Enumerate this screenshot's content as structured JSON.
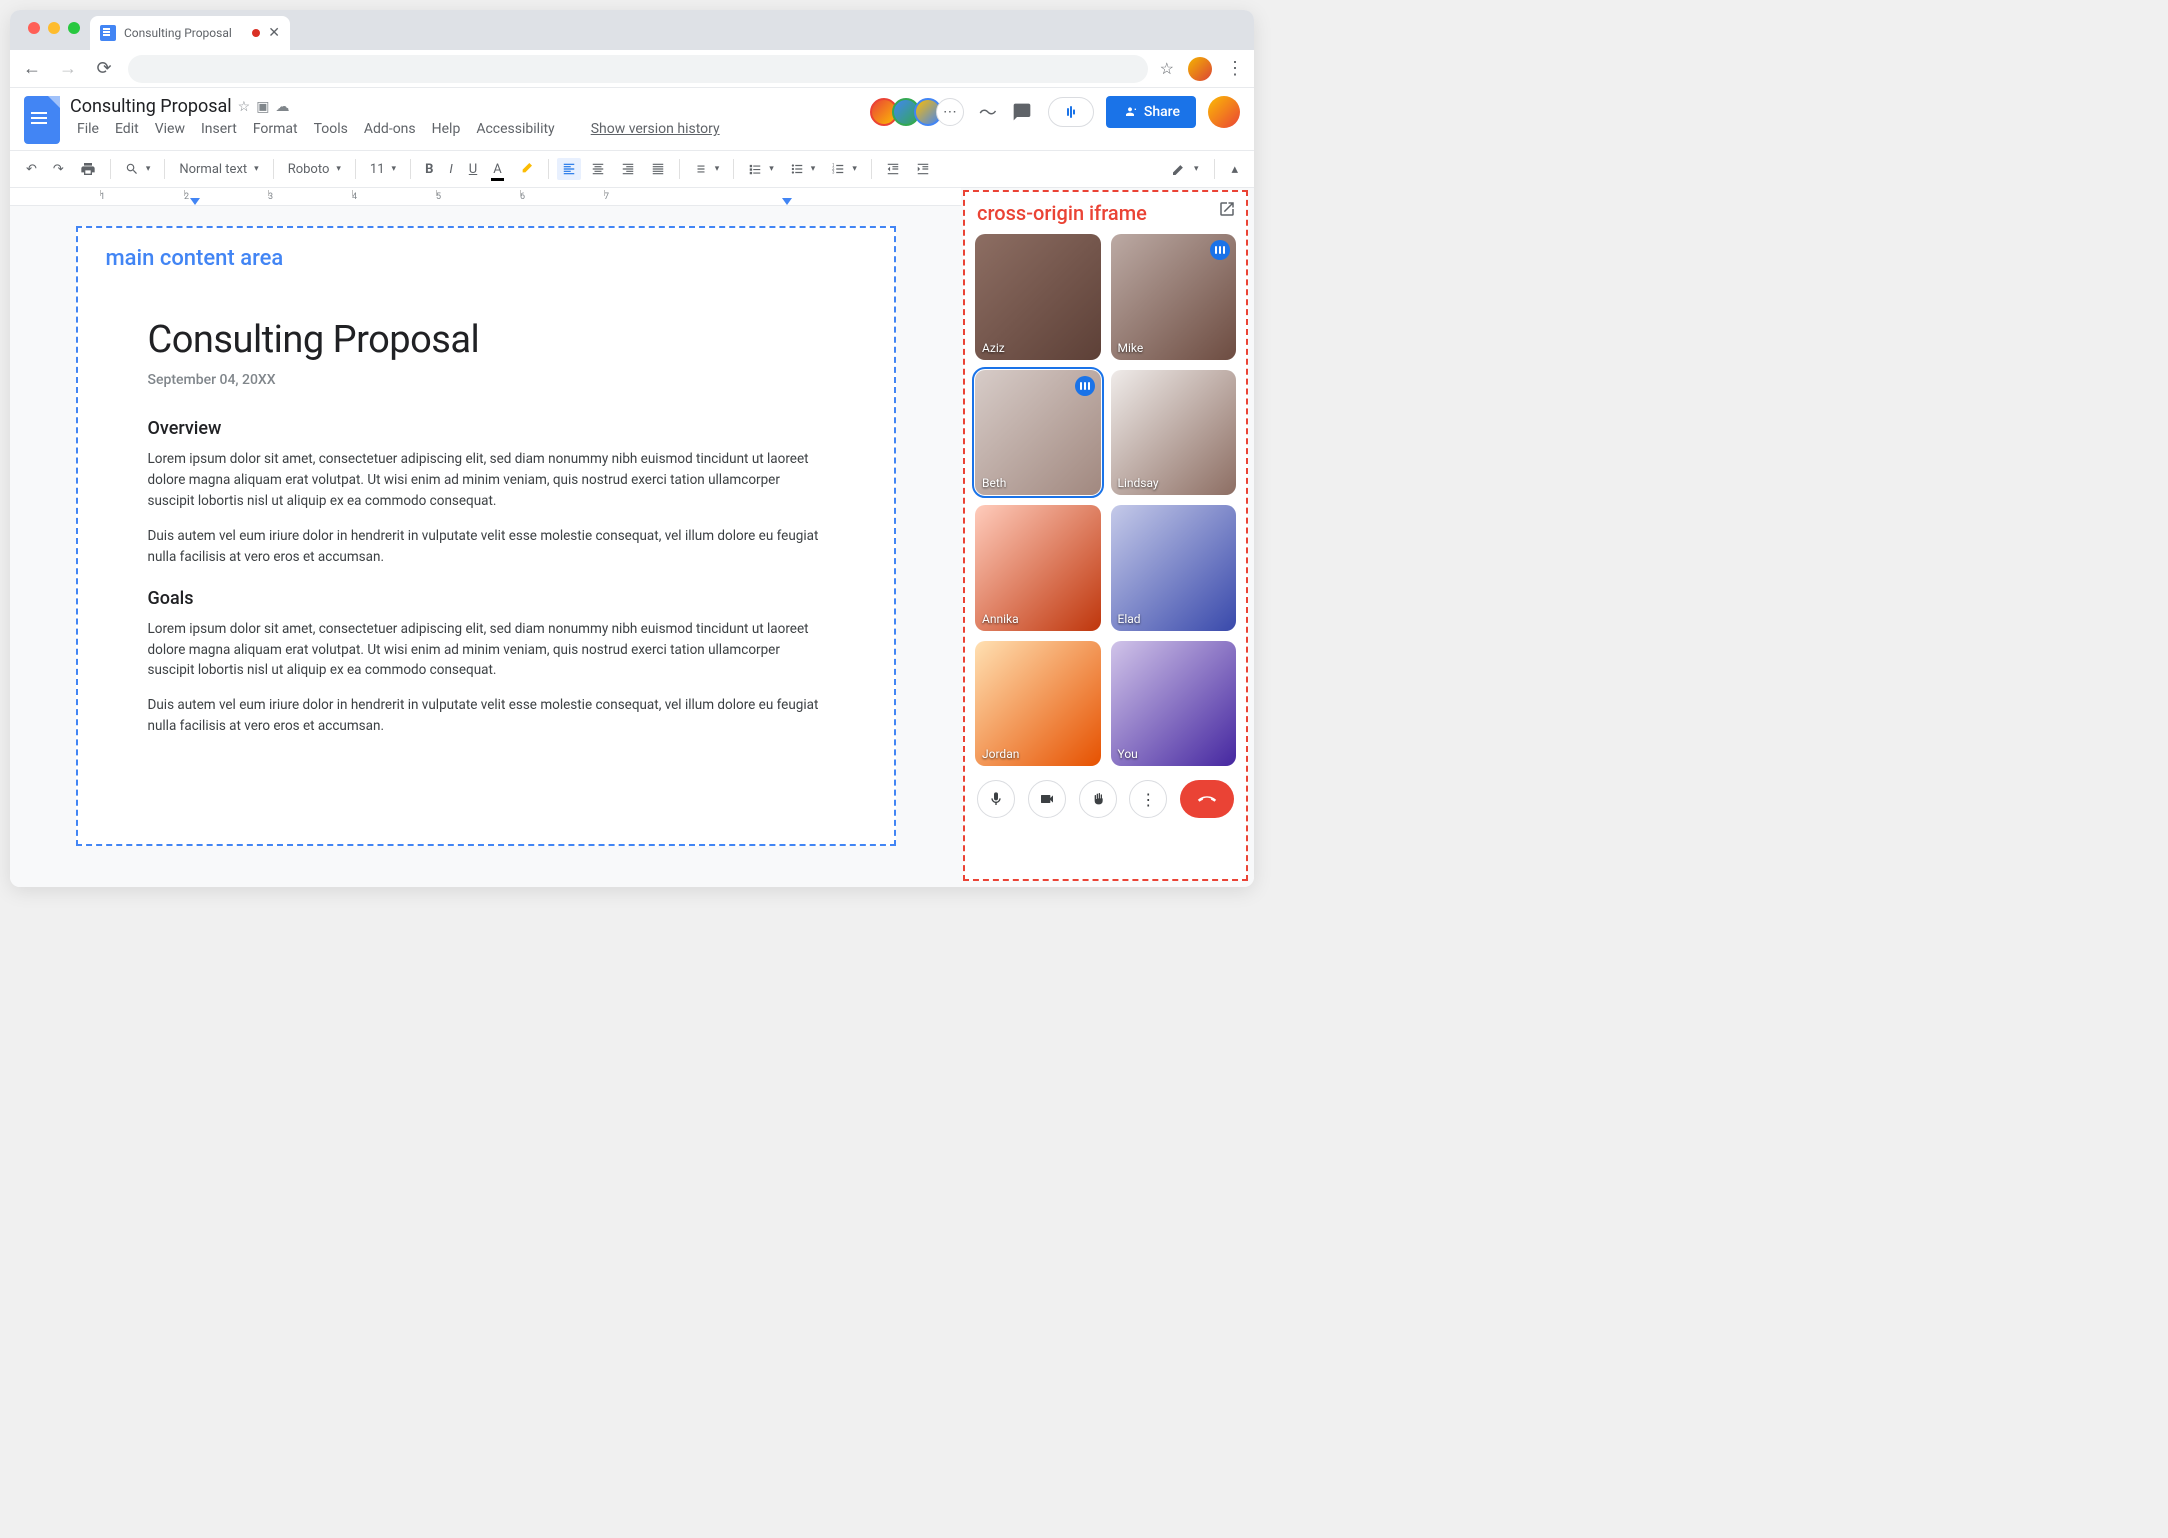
{
  "browser": {
    "tab_title": "Consulting Proposal"
  },
  "docs": {
    "title": "Consulting Proposal",
    "menubar": {
      "file": "File",
      "edit": "Edit",
      "view": "View",
      "insert": "Insert",
      "format": "Format",
      "tools": "Tools",
      "addons": "Add-ons",
      "help": "Help",
      "accessibility": "Accessibility",
      "version_history": "Show version history"
    },
    "share_label": "Share"
  },
  "toolbar": {
    "style": "Normal text",
    "font": "Roboto",
    "size": "11"
  },
  "ruler": {
    "ticks": [
      "1",
      "2",
      "3",
      "4",
      "5",
      "6",
      "7"
    ]
  },
  "annotations": {
    "main_content": "main content area",
    "iframe": "cross-origin iframe"
  },
  "document": {
    "heading": "Consulting Proposal",
    "date": "September 04, 20XX",
    "section1_title": "Overview",
    "section1_p1": "Lorem ipsum dolor sit amet, consectetuer adipiscing elit, sed diam nonummy nibh euismod tincidunt ut laoreet dolore magna aliquam erat volutpat. Ut wisi enim ad minim veniam, quis nostrud exerci tation ullamcorper suscipit lobortis nisl ut aliquip ex ea commodo consequat.",
    "section1_p2": "Duis autem vel eum iriure dolor in hendrerit in vulputate velit esse molestie consequat, vel illum dolore eu feugiat nulla facilisis at vero eros et accumsan.",
    "section2_title": "Goals",
    "section2_p1": "Lorem ipsum dolor sit amet, consectetuer adipiscing elit, sed diam nonummy nibh euismod tincidunt ut laoreet dolore magna aliquam erat volutpat. Ut wisi enim ad minim veniam, quis nostrud exerci tation ullamcorper suscipit lobortis nisl ut aliquip ex ea commodo consequat.",
    "section2_p2": "Duis autem vel eum iriure dolor in hendrerit in vulputate velit esse molestie consequat, vel illum dolore eu feugiat nulla facilisis at vero eros et accumsan."
  },
  "meet": {
    "participants": [
      {
        "name": "Aziz",
        "speaking": false,
        "active": false
      },
      {
        "name": "Mike",
        "speaking": true,
        "active": false
      },
      {
        "name": "Beth",
        "speaking": true,
        "active": true
      },
      {
        "name": "Lindsay",
        "speaking": false,
        "active": false
      },
      {
        "name": "Annika",
        "speaking": false,
        "active": false
      },
      {
        "name": "Elad",
        "speaking": false,
        "active": false
      },
      {
        "name": "Jordan",
        "speaking": false,
        "active": false
      },
      {
        "name": "You",
        "speaking": false,
        "active": false
      }
    ]
  }
}
